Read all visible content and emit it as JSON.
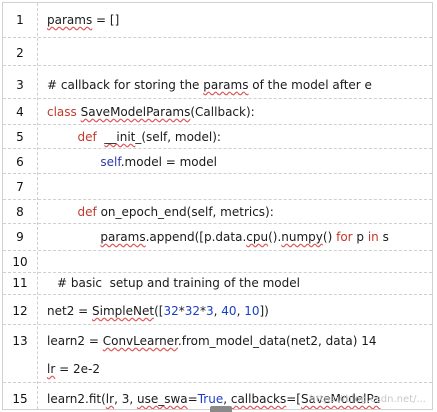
{
  "lines": [
    {
      "n": "1",
      "parts": [
        {
          "t": "params",
          "c": "sq"
        },
        {
          "t": " = []"
        }
      ]
    },
    {
      "n": "2",
      "parts": []
    },
    {
      "n": "3",
      "parts": [
        {
          "t": "# callback for storing the "
        },
        {
          "t": "params",
          "c": "sq"
        },
        {
          "t": " of the model after e"
        }
      ]
    },
    {
      "n": "4",
      "parts": [
        {
          "t": "class ",
          "c": "kw"
        },
        {
          "t": "SaveModelParams",
          "c": "sq"
        },
        {
          "t": "(Callback):"
        }
      ]
    },
    {
      "n": "5",
      "parts": [
        {
          "t": "        "
        },
        {
          "t": "def",
          "c": "kw"
        },
        {
          "t": "  "
        },
        {
          "t": "__init",
          "c": "sq"
        },
        {
          "t": "_(self, model):"
        }
      ]
    },
    {
      "n": "6",
      "parts": [
        {
          "t": "              "
        },
        {
          "t": "self",
          "c": "self"
        },
        {
          "t": ".model = model"
        }
      ]
    },
    {
      "n": "7",
      "parts": []
    },
    {
      "n": "8",
      "parts": [
        {
          "t": "        "
        },
        {
          "t": "def",
          "c": "kw"
        },
        {
          "t": " on_epoch_end(self, metrics):"
        }
      ]
    },
    {
      "n": "9",
      "parts": [
        {
          "t": "              "
        },
        {
          "t": "params",
          "c": "sq"
        },
        {
          "t": ".append([p.data."
        },
        {
          "t": "cpu",
          "c": "sq"
        },
        {
          "t": "()."
        },
        {
          "t": "numpy",
          "c": "sq"
        },
        {
          "t": "() "
        },
        {
          "t": "for",
          "c": "kw"
        },
        {
          "t": " p "
        },
        {
          "t": "in",
          "c": "kw"
        },
        {
          "t": " s"
        }
      ]
    },
    {
      "n": "10",
      "parts": []
    },
    {
      "n": "11",
      "parts": [
        {
          "t": "# basic  setup and training of the model"
        }
      ]
    },
    {
      "n": "12",
      "parts": [
        {
          "t": "net2 = "
        },
        {
          "t": "SimpleNet",
          "c": "sq"
        },
        {
          "t": "(["
        },
        {
          "t": "32",
          "c": "num"
        },
        {
          "t": "*"
        },
        {
          "t": "32",
          "c": "num"
        },
        {
          "t": "*"
        },
        {
          "t": "3",
          "c": "num"
        },
        {
          "t": ", "
        },
        {
          "t": "40",
          "c": "num"
        },
        {
          "t": ", "
        },
        {
          "t": "10",
          "c": "num"
        },
        {
          "t": "])"
        }
      ]
    },
    {
      "n": "13",
      "parts": [
        {
          "t": "learn2 = "
        },
        {
          "t": "ConvLearner",
          "c": "sq"
        },
        {
          "t": ".from_model_data(net2, data) 14"
        }
      ],
      "extra": [
        {
          "t": "lr",
          "c": "sq"
        },
        {
          "t": " = 2e-2"
        }
      ]
    },
    {
      "n": "15",
      "parts": [
        {
          "t": "learn2.fit("
        },
        {
          "t": "lr",
          "c": "sq"
        },
        {
          "t": ", 3, "
        },
        {
          "t": "use_swa",
          "c": "sq"
        },
        {
          "t": "="
        },
        {
          "t": "True",
          "c": "num"
        },
        {
          "t": ", "
        },
        {
          "t": "callbacks",
          "c": "sq"
        },
        {
          "t": "=["
        },
        {
          "t": "SaveModelPa",
          "c": "sq"
        }
      ]
    }
  ],
  "watermark": "https://blog.csdn.net/..."
}
